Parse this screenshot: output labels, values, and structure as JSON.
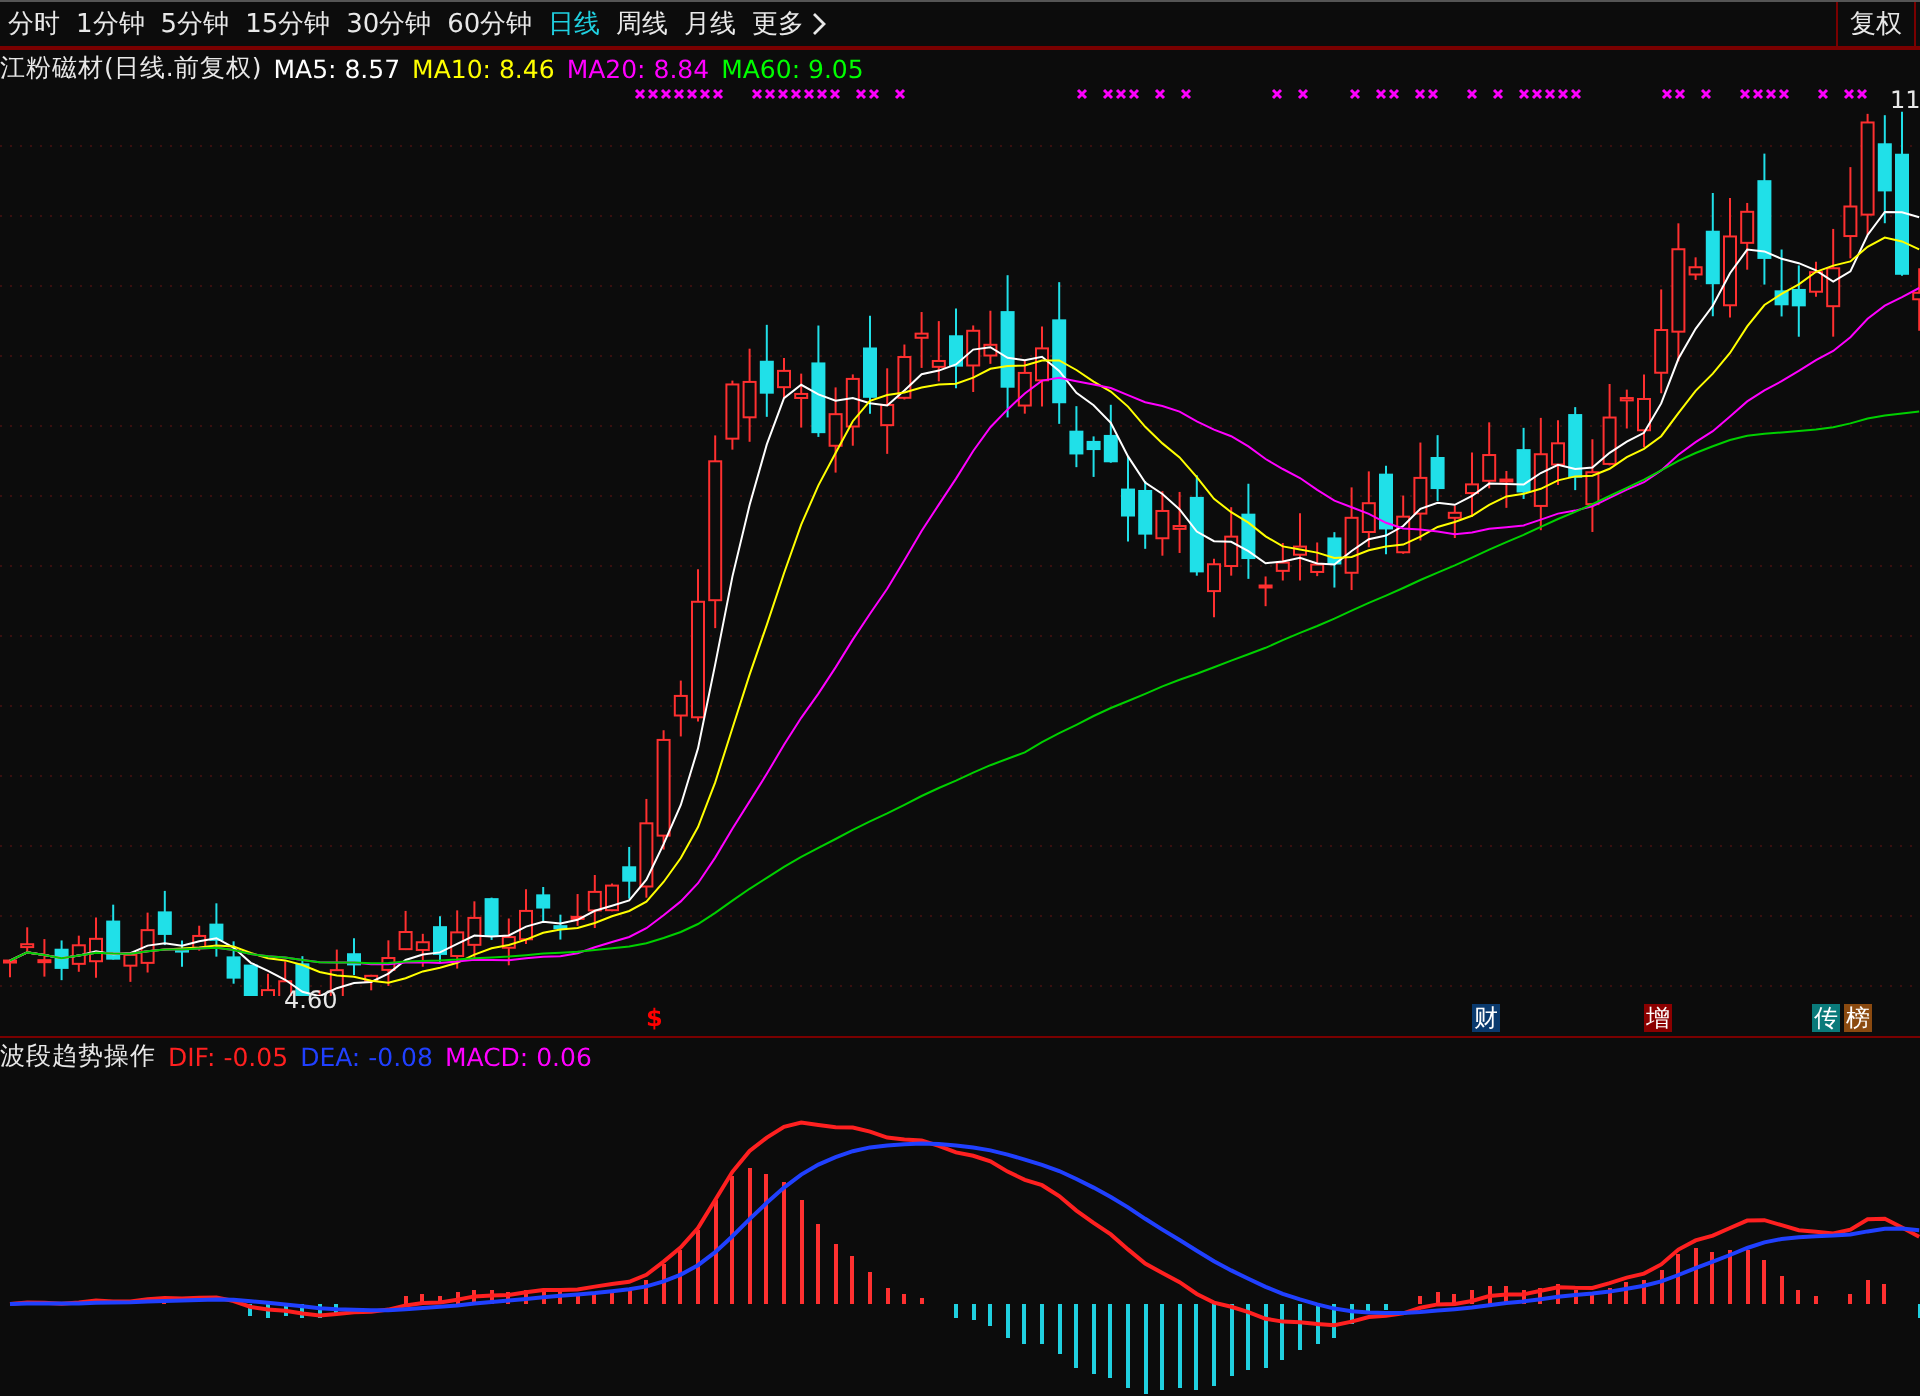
{
  "toolbar": {
    "periods": [
      {
        "label": "分时",
        "selected": false
      },
      {
        "label": "1分钟",
        "selected": false
      },
      {
        "label": "5分钟",
        "selected": false
      },
      {
        "label": "15分钟",
        "selected": false
      },
      {
        "label": "30分钟",
        "selected": false
      },
      {
        "label": "60分钟",
        "selected": false
      },
      {
        "label": "日线",
        "selected": true
      },
      {
        "label": "周线",
        "selected": false
      },
      {
        "label": "月线",
        "selected": false
      }
    ],
    "more": "更多",
    "adjust_button": "复权"
  },
  "main_chart": {
    "title": "江粉磁材(日线.前复权)",
    "indicators": [
      {
        "label": "MA5: 8.57",
        "color": "#ffffff"
      },
      {
        "label": "MA10: 8.46",
        "color": "#ffff00"
      },
      {
        "label": "MA20: 8.84",
        "color": "#ff00ff"
      },
      {
        "label": "MA60: 9.05",
        "color": "#00ff00"
      }
    ],
    "low_label": "4.60",
    "high_label": "11",
    "markers": [
      {
        "label": "$",
        "color": "#ff0000",
        "kind": "glyph"
      },
      {
        "label": "财",
        "color": "#0a3a6e",
        "kind": "tag"
      },
      {
        "label": "增",
        "color": "#8b0000",
        "kind": "tag"
      },
      {
        "label": "传",
        "color": "#0a7a7a",
        "kind": "tag"
      },
      {
        "label": "榜",
        "color": "#8b4a10",
        "kind": "tag"
      }
    ]
  },
  "macd_chart": {
    "title": "波段趋势操作",
    "indicators": [
      {
        "label": "DIF: -0.05",
        "color": "#ff2020"
      },
      {
        "label": "DEA: -0.08",
        "color": "#2040ff"
      },
      {
        "label": "MACD: 0.06",
        "color": "#ff00ff"
      }
    ]
  }
}
